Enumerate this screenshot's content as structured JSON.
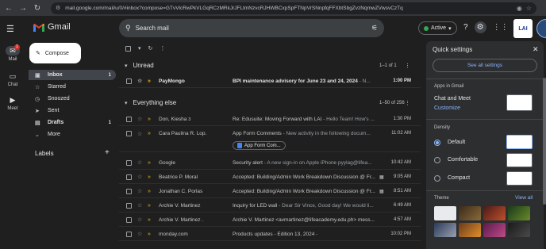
{
  "browser": {
    "url": "mail.google.com/mail/u/0/#inbox?compose=GTvVlcRwPkVLGqRCzMRkJrJFLtmNzvcRJHWBCxpSpFTNpVrSNnpfqFFXbtSbgZvzNqmwZVwsvCzTq"
  },
  "app": {
    "name": "Gmail"
  },
  "rail": {
    "mail_label": "Mail",
    "mail_badge": "1",
    "chat_label": "Chat",
    "meet_label": "Meet"
  },
  "search": {
    "placeholder": "Search mail"
  },
  "status": {
    "label": "Active"
  },
  "account": {
    "org_badge": "LAI"
  },
  "compose": {
    "label": "Compose"
  },
  "nav": [
    {
      "label": "Inbox",
      "count": "1",
      "icon": "inbox-icon"
    },
    {
      "label": "Starred",
      "count": "",
      "icon": "star-icon"
    },
    {
      "label": "Snoozed",
      "count": "",
      "icon": "clock-icon"
    },
    {
      "label": "Sent",
      "count": "",
      "icon": "send-icon"
    },
    {
      "label": "Drafts",
      "count": "1",
      "icon": "draft-icon"
    },
    {
      "label": "More",
      "count": "",
      "icon": "chevron-down-icon"
    }
  ],
  "labels": {
    "heading": "Labels"
  },
  "sections": {
    "unread": {
      "title": "Unread",
      "count": "1–1 of 1"
    },
    "everything": {
      "title": "Everything else",
      "count": "1–50 of 256"
    }
  },
  "unread_rows": [
    {
      "sender": "PayMongo",
      "subject": "BPI maintenance advisory for June 23 and 24, 2024",
      "snippet": " - N...",
      "time": "1:00 PM"
    }
  ],
  "rows": [
    {
      "sender": "Don, Kiesha",
      "sender_count": "3",
      "subject": "Re: Edusuite: Moving Forward with LAI",
      "snippet": " - Hello Team! How's ...",
      "time": "1:30 PM"
    },
    {
      "sender": "Cara Paulina R. Lop.",
      "subject": "App Form Comments",
      "snippet": " - New activity in the following docum...",
      "time": "11:02 AM",
      "chip": "App Form Com..."
    },
    {
      "sender": "Google",
      "subject": "Security alert",
      "snippet": " - A new sign-in on Apple iPhone pyylag@lifea...",
      "time": "10:42 AM"
    },
    {
      "sender": "Beatrice P. Moral",
      "subject": "Accepted: Building/Admin Work Breakdown Discussion @ Fr...",
      "snippet": "",
      "time": "9:05 AM",
      "cal": true
    },
    {
      "sender": "Jonathan C. Porlas",
      "subject": "Accepted: Building/Admin Work Breakdown Discussion @ Fr...",
      "snippet": "",
      "time": "8:51 AM",
      "cal": true
    },
    {
      "sender": "Archie V. Martinez",
      "subject": "Inquiry for LED wall",
      "snippet": " - Dear Sir Vince, Good day! We would li...",
      "time": "6:49 AM"
    },
    {
      "sender": "Archie V. Martinez .",
      "subject": "Archie V. Martinez <avmartinez@lifeacademy.edu.ph> mess...",
      "snippet": "",
      "time": "4:57 AM"
    },
    {
      "sender": "monday.com",
      "subject": "Products updates - Edition 13, 2024",
      "snippet": " -",
      "time": "10:02 PM"
    }
  ],
  "quick_settings": {
    "title": "Quick settings",
    "see_all": "See all settings",
    "apps_heading": "Apps in Gmail",
    "chat_meet": "Chat and Meet",
    "customize": "Customize",
    "density_heading": "Density",
    "density_options": [
      "Default",
      "Comfortable",
      "Compact"
    ],
    "density_selected": "Default",
    "theme_heading": "Theme",
    "view_all": "View all"
  },
  "colors": {
    "accent": "#8ab4f8",
    "important": "#f2b600",
    "badge": "#d93025",
    "active_dot": "#34a853"
  }
}
